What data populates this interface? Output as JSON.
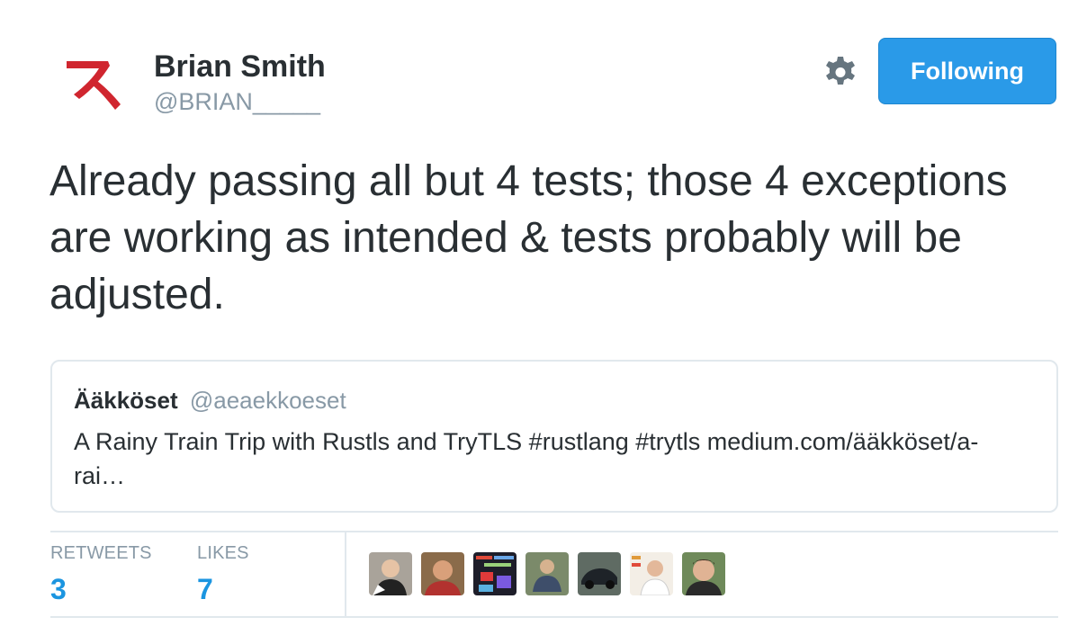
{
  "user": {
    "name": "Brian Smith",
    "handle": "@BRIAN_____",
    "avatar_icon": "katakana-su-logo-icon",
    "avatar_color": "#d0262f"
  },
  "actions": {
    "settings_icon": "gear-icon",
    "follow_label": "Following",
    "follow_color": "#2a9ae8"
  },
  "tweet": {
    "text": "Already passing all but 4 tests; those 4 exceptions are working as intended & tests probably will be adjusted."
  },
  "quoted": {
    "name": "Ääkköset",
    "handle": "@aeaekkoeset",
    "text": "A Rainy Train Trip with Rustls and TryTLS #rustlang #trytls medium.com/ääkköset/a-rai…"
  },
  "stats": {
    "retweets_label": "RETWEETS",
    "retweets_count": "3",
    "likes_label": "LIKES",
    "likes_count": "7",
    "accent_color": "#1b95e0"
  },
  "likers": [
    {
      "icon": "user-avatar-icon"
    },
    {
      "icon": "user-avatar-icon"
    },
    {
      "icon": "user-avatar-icon"
    },
    {
      "icon": "user-avatar-icon"
    },
    {
      "icon": "user-avatar-icon"
    },
    {
      "icon": "user-avatar-icon"
    },
    {
      "icon": "user-avatar-icon"
    }
  ]
}
